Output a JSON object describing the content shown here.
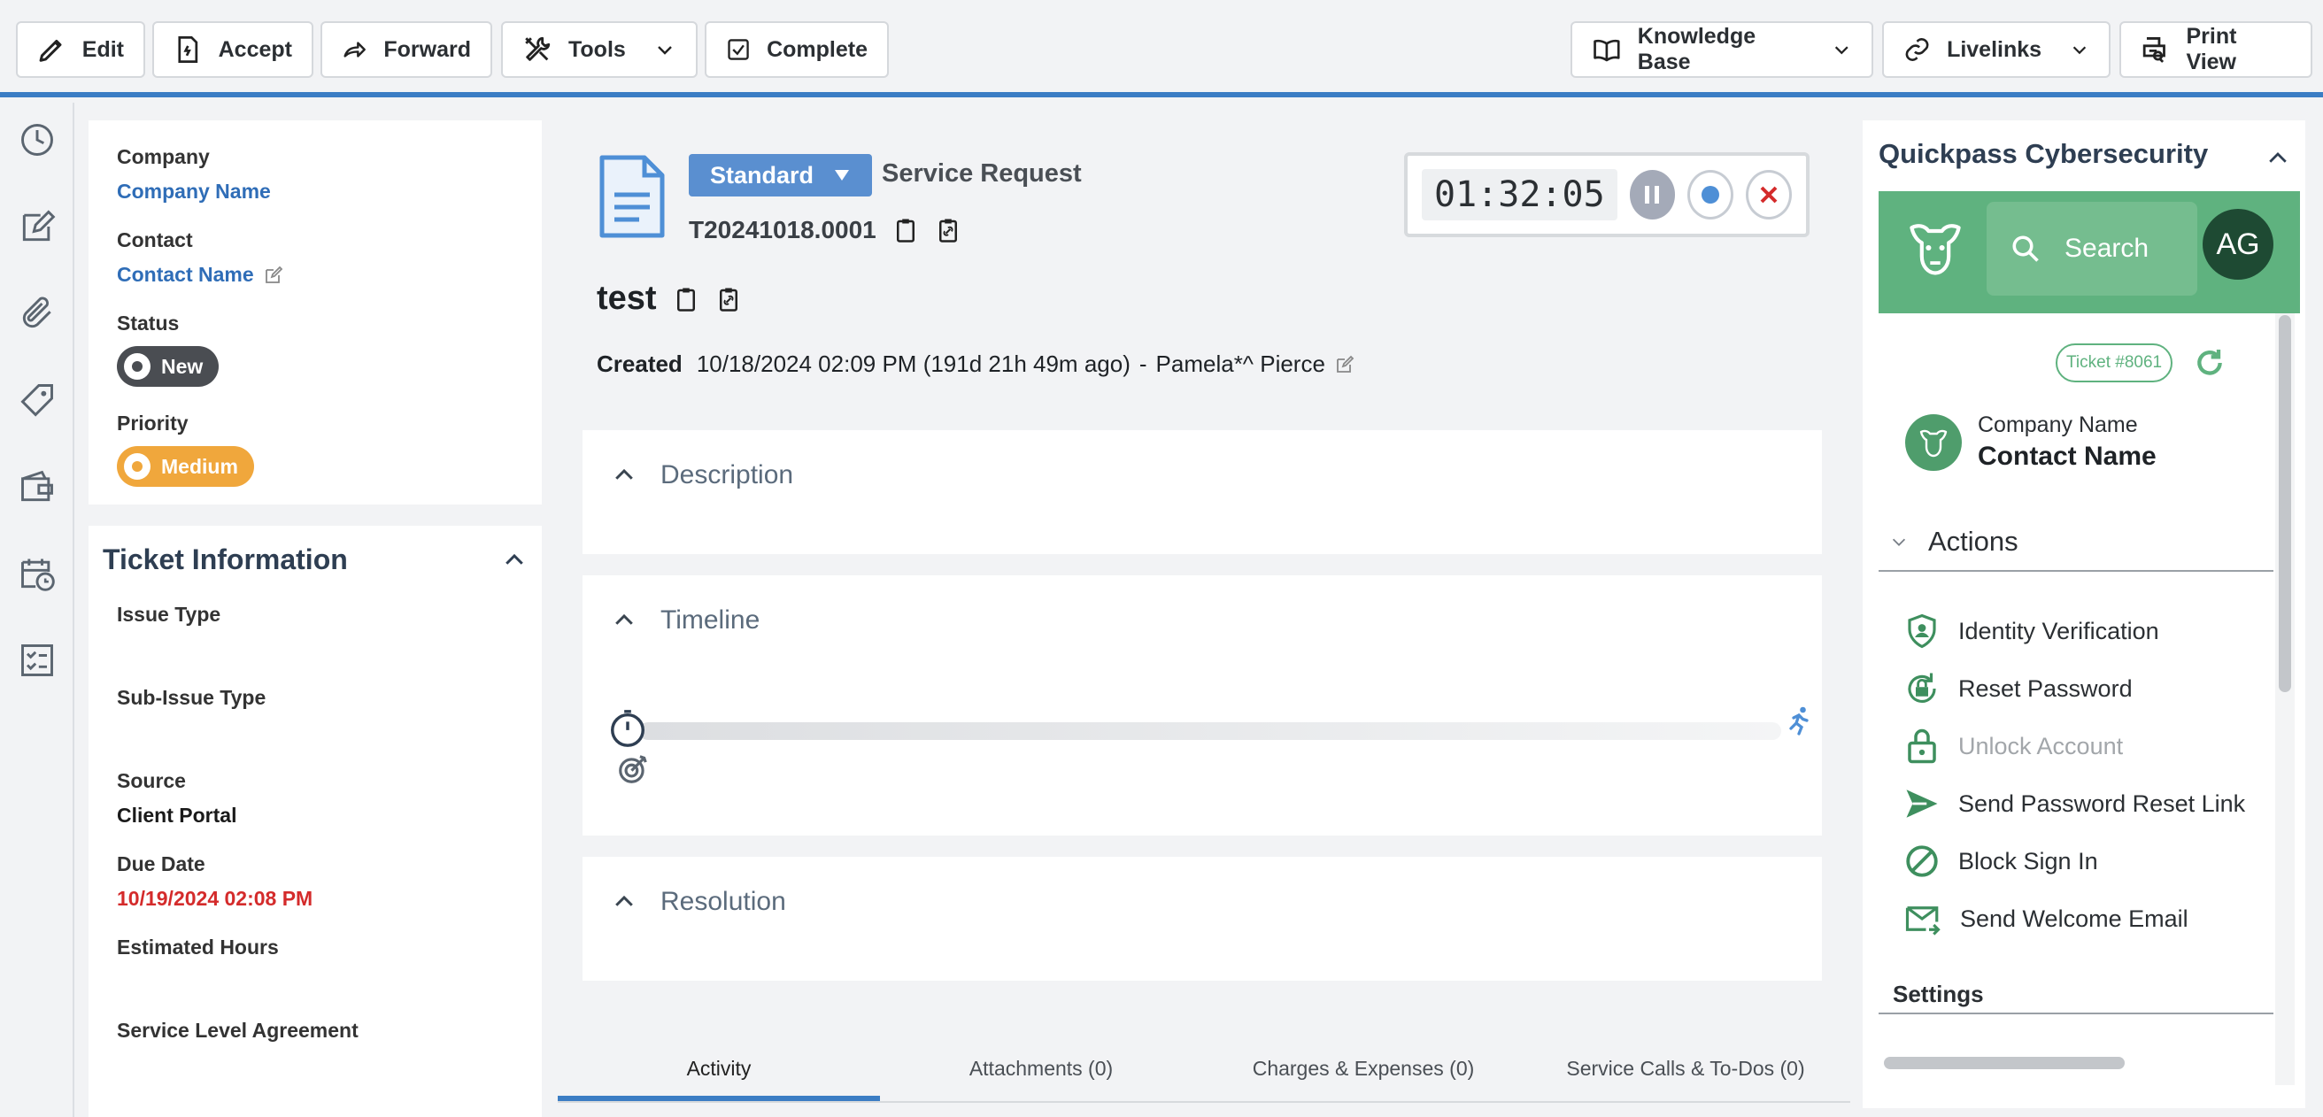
{
  "toolbar": {
    "edit": "Edit",
    "accept": "Accept",
    "forward": "Forward",
    "tools": "Tools",
    "complete": "Complete",
    "knowledge_base": "Knowledge Base",
    "livelinks": "Livelinks",
    "print_view": "Print View"
  },
  "rail": [
    "clock-icon",
    "edit-note-icon",
    "attachment-icon",
    "tag-icon",
    "wallet-icon",
    "calendar-clock-icon",
    "checklist-icon"
  ],
  "summary": {
    "company_label": "Company",
    "company_value": "Company Name",
    "contact_label": "Contact",
    "contact_value": "Contact Name",
    "status_label": "Status",
    "status_value": "New",
    "priority_label": "Priority",
    "priority_value": "Medium"
  },
  "ticket_info": {
    "title": "Ticket Information",
    "issue_type_label": "Issue Type",
    "sub_issue_type_label": "Sub-Issue Type",
    "source_label": "Source",
    "source_value": "Client Portal",
    "due_date_label": "Due Date",
    "due_date_value": "10/19/2024 02:08 PM",
    "estimated_hours_label": "Estimated Hours",
    "sla_label": "Service Level Agreement"
  },
  "ticket": {
    "category": "Standard",
    "type": "Service Request",
    "number": "T20241018.0001",
    "title": "test",
    "created_label": "Created",
    "created_value": "10/18/2024 02:09 PM (191d 21h 49m ago)",
    "separator": "-",
    "creator": "Pamela*^ Pierce",
    "timer": "01:32:05"
  },
  "sections": {
    "description": "Description",
    "timeline": "Timeline",
    "resolution": "Resolution"
  },
  "tabs": [
    "Activity",
    "Attachments (0)",
    "Charges & Expenses (0)",
    "Service Calls & To-Dos (0)"
  ],
  "quickpass": {
    "title": "Quickpass Cybersecurity",
    "search_placeholder": "Search",
    "avatar": "AG",
    "ticket_badge": "Ticket #8061",
    "company": "Company Name",
    "contact": "Contact Name",
    "actions_label": "Actions",
    "actions": [
      "Identity Verification",
      "Reset Password",
      "Unlock Account",
      "Send Password Reset Link",
      "Block Sign In",
      "Send Welcome Email"
    ],
    "settings_label": "Settings"
  },
  "colors": {
    "accent": "#3b7dc4",
    "status_new": "#4a4d52",
    "priority_medium": "#f0a73c",
    "quickpass_green": "#5fb27f",
    "due_date": "#d42b2b"
  }
}
